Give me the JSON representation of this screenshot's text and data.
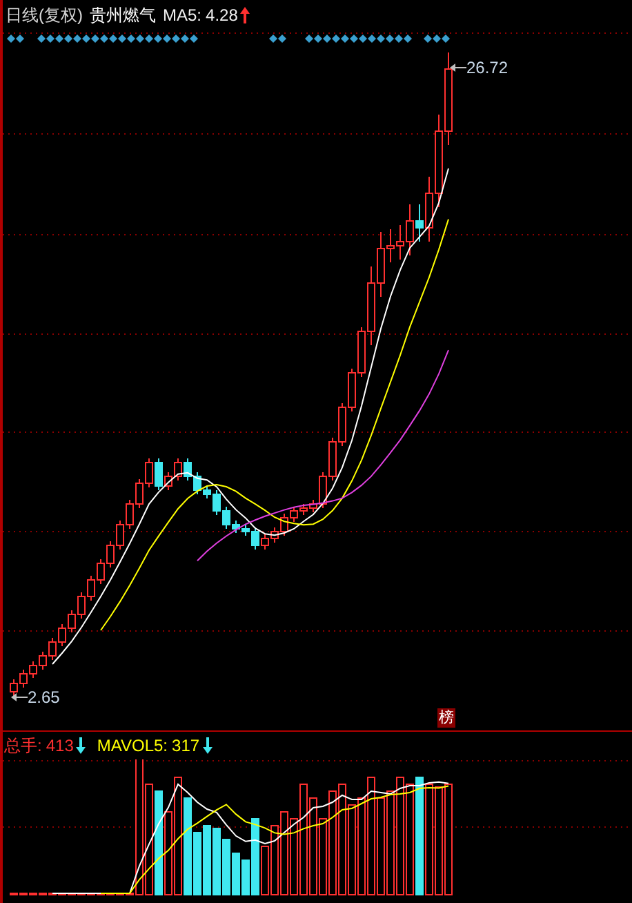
{
  "header": {
    "period": "日线(复权)",
    "name": "贵州燃气",
    "ma": {
      "label": "MA5:",
      "value": "4.28",
      "rising": true
    }
  },
  "price_panel": {
    "high_label": "26.72",
    "low_label": "2.65",
    "badge": "榜"
  },
  "volume_panel": {
    "volume": {
      "label": "总手:",
      "value": "413",
      "rising": false
    },
    "mavol": {
      "label": "MAVOL5:",
      "value": "317",
      "rising": false
    }
  }
}
